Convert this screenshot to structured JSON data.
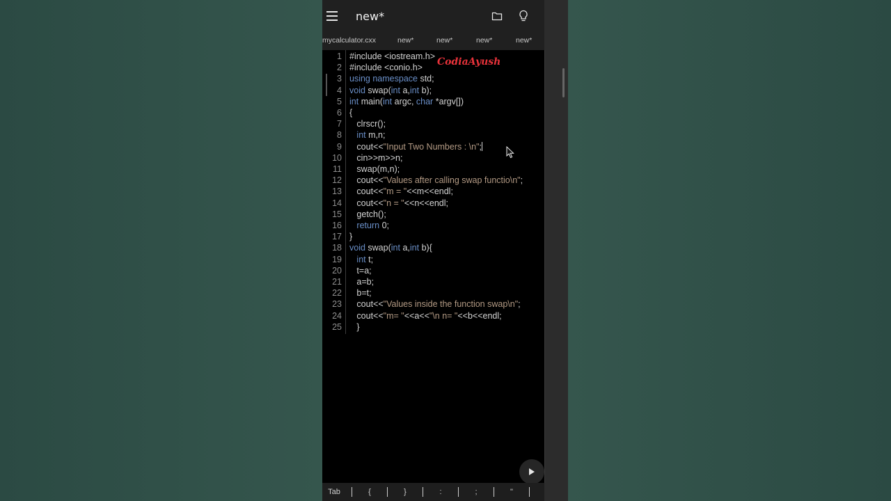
{
  "appbar": {
    "title": "new*",
    "icons": [
      "menu-icon",
      "folder-icon",
      "lightbulb-icon"
    ]
  },
  "tabs": [
    "mycalculator.cxx",
    "new*",
    "new*",
    "new*",
    "new*"
  ],
  "watermark": "CodiaAyush",
  "code_lines": [
    [
      {
        "t": "#include <iostream.h>",
        "c": ""
      }
    ],
    [
      {
        "t": "#include <conio.h>",
        "c": ""
      }
    ],
    [
      {
        "t": "using namespace ",
        "c": "kw"
      },
      {
        "t": "std;",
        "c": ""
      }
    ],
    [
      {
        "t": "void ",
        "c": "kw"
      },
      {
        "t": "swap(",
        "c": ""
      },
      {
        "t": "int ",
        "c": "kw"
      },
      {
        "t": "a,",
        "c": ""
      },
      {
        "t": "int ",
        "c": "kw"
      },
      {
        "t": "b);",
        "c": ""
      }
    ],
    [
      {
        "t": "int ",
        "c": "kw"
      },
      {
        "t": "main(",
        "c": ""
      },
      {
        "t": "int ",
        "c": "kw"
      },
      {
        "t": "argc, ",
        "c": ""
      },
      {
        "t": "char ",
        "c": "kw"
      },
      {
        "t": "*argv[])",
        "c": ""
      }
    ],
    [
      {
        "t": "{",
        "c": ""
      }
    ],
    [
      {
        "t": "   clrscr();",
        "c": ""
      }
    ],
    [
      {
        "t": "   ",
        "c": ""
      },
      {
        "t": "int ",
        "c": "kw"
      },
      {
        "t": "m,n;",
        "c": ""
      }
    ],
    [
      {
        "t": "   cout<<",
        "c": ""
      },
      {
        "t": "\"Input Two Numbers : \\n\"",
        "c": "str"
      },
      {
        "t": ";",
        "c": ""
      },
      {
        "t": "",
        "c": "cursor"
      }
    ],
    [
      {
        "t": "   cin>>m>>n;",
        "c": ""
      }
    ],
    [
      {
        "t": "   swap(m,n);",
        "c": ""
      }
    ],
    [
      {
        "t": "   cout<<",
        "c": ""
      },
      {
        "t": "\"Values after calling swap functio\\n\"",
        "c": "str"
      },
      {
        "t": ";",
        "c": ""
      }
    ],
    [
      {
        "t": "   cout<<",
        "c": ""
      },
      {
        "t": "\"m = \"",
        "c": "str"
      },
      {
        "t": "<<m<<endl;",
        "c": ""
      }
    ],
    [
      {
        "t": "   cout<<",
        "c": ""
      },
      {
        "t": "\"n = \"",
        "c": "str"
      },
      {
        "t": "<<n<<endl;",
        "c": ""
      }
    ],
    [
      {
        "t": "   getch();",
        "c": ""
      }
    ],
    [
      {
        "t": "   ",
        "c": ""
      },
      {
        "t": "return ",
        "c": "kw"
      },
      {
        "t": "0;",
        "c": ""
      }
    ],
    [
      {
        "t": "}",
        "c": ""
      }
    ],
    [
      {
        "t": "void ",
        "c": "kw"
      },
      {
        "t": "swap(",
        "c": ""
      },
      {
        "t": "int ",
        "c": "kw"
      },
      {
        "t": "a,",
        "c": ""
      },
      {
        "t": "int ",
        "c": "kw"
      },
      {
        "t": "b){",
        "c": ""
      }
    ],
    [
      {
        "t": "   ",
        "c": ""
      },
      {
        "t": "int ",
        "c": "kw"
      },
      {
        "t": "t;",
        "c": ""
      }
    ],
    [
      {
        "t": "   t=a;",
        "c": ""
      }
    ],
    [
      {
        "t": "   a=b;",
        "c": ""
      }
    ],
    [
      {
        "t": "   b=t;",
        "c": ""
      }
    ],
    [
      {
        "t": "   cout<<",
        "c": ""
      },
      {
        "t": "\"Values inside the function swap\\n\"",
        "c": "str"
      },
      {
        "t": ";",
        "c": ""
      }
    ],
    [
      {
        "t": "   cout<<",
        "c": ""
      },
      {
        "t": "\"m= \"",
        "c": "str"
      },
      {
        "t": "<<a<<",
        "c": ""
      },
      {
        "t": "\"\\n n= \"",
        "c": "str"
      },
      {
        "t": "<<b<<endl;",
        "c": ""
      }
    ],
    [
      {
        "t": "   }",
        "c": ""
      }
    ]
  ],
  "run_button": "play-icon",
  "keybar": [
    "Tab",
    "{",
    "}",
    ":",
    ";",
    "\""
  ],
  "colors": {
    "keyword": "#6a8fc8",
    "string": "#b39a84",
    "text": "#d4d4d4",
    "background": "#000000",
    "watermark": "#e8323a"
  }
}
